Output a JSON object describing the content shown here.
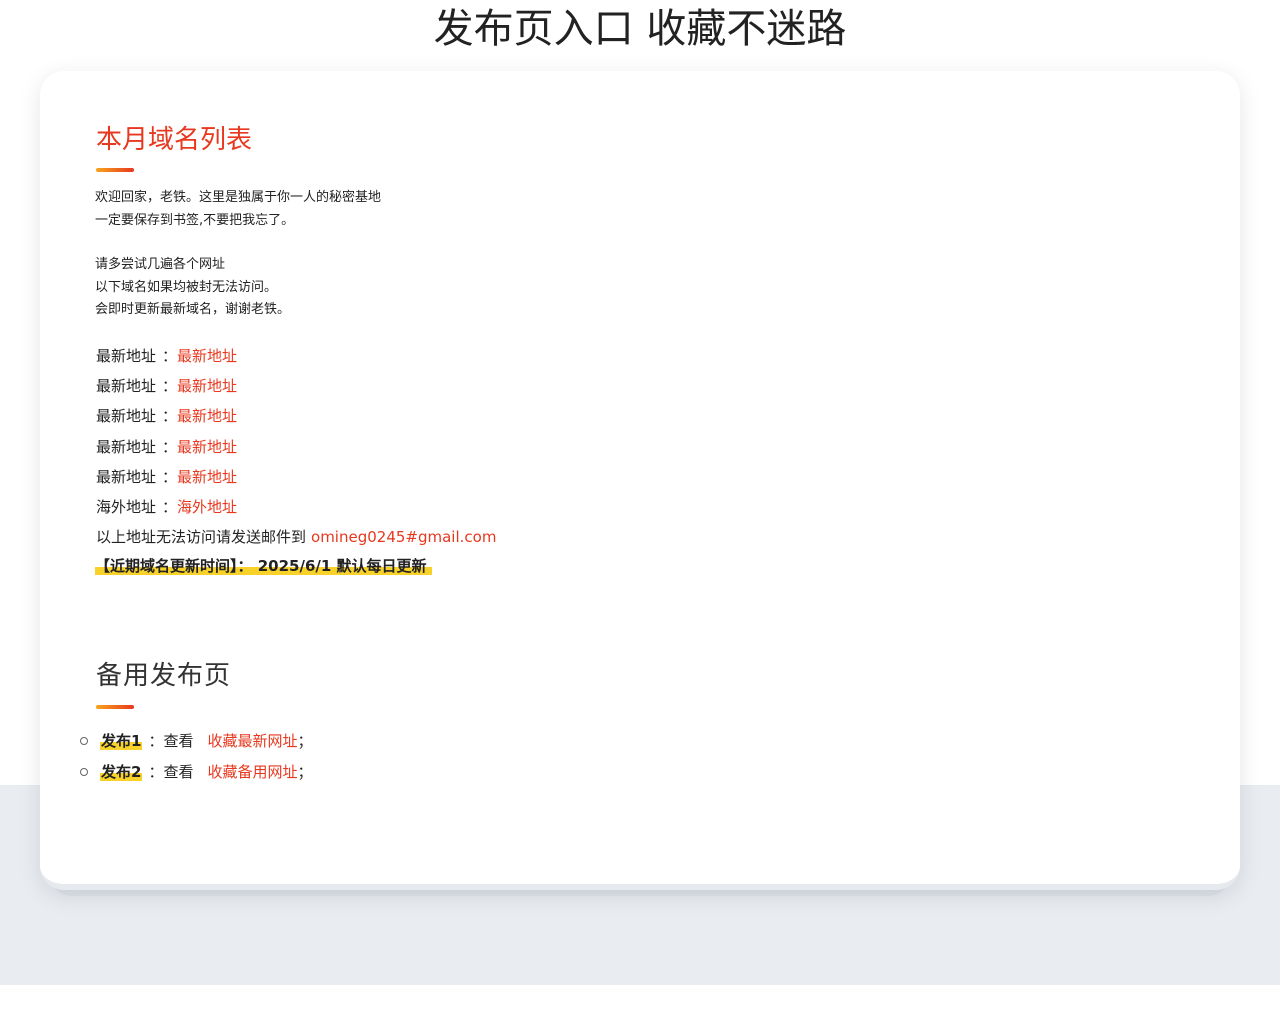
{
  "page": {
    "title": "发布页入口 收藏不迷路"
  },
  "domains": {
    "title": "本月域名列表",
    "intro": [
      "欢迎回家，老铁。这里是独属于你一人的秘密基地",
      "一定要保存到书签,不要把我忘了。",
      "请多尝试几遍各个网址",
      "以下域名如果均被封无法访问。",
      "会即时更新最新域名，谢谢老铁。"
    ],
    "addresses": [
      {
        "label": "最新地址",
        "sep": "：",
        "link": "最新地址"
      },
      {
        "label": "最新地址",
        "sep": "：",
        "link": "最新地址"
      },
      {
        "label": "最新地址",
        "sep": "：",
        "link": "最新地址"
      },
      {
        "label": "最新地址",
        "sep": "：",
        "link": "最新地址"
      },
      {
        "label": "最新地址",
        "sep": "：",
        "link": "最新地址"
      },
      {
        "label": "海外地址",
        "sep": "：",
        "link": "海外地址"
      }
    ],
    "email_prefix": "以上地址无法访问请发送邮件到",
    "email": "omineg0245#gmail.com",
    "update_notice": "【近期域名更新时间】： 2025/6/1 默认每日更新"
  },
  "backup": {
    "title": "备用发布页",
    "items": [
      {
        "name": "发布1",
        "sep": "：查看",
        "link": "收藏最新网址",
        "end": "；"
      },
      {
        "name": "发布2",
        "sep": "：查看",
        "link": "收藏备用网址",
        "end": "；"
      }
    ]
  },
  "colors": {
    "accent": "#e8381f",
    "highlight": "#f8d22a",
    "band": "#e9ecf1"
  }
}
